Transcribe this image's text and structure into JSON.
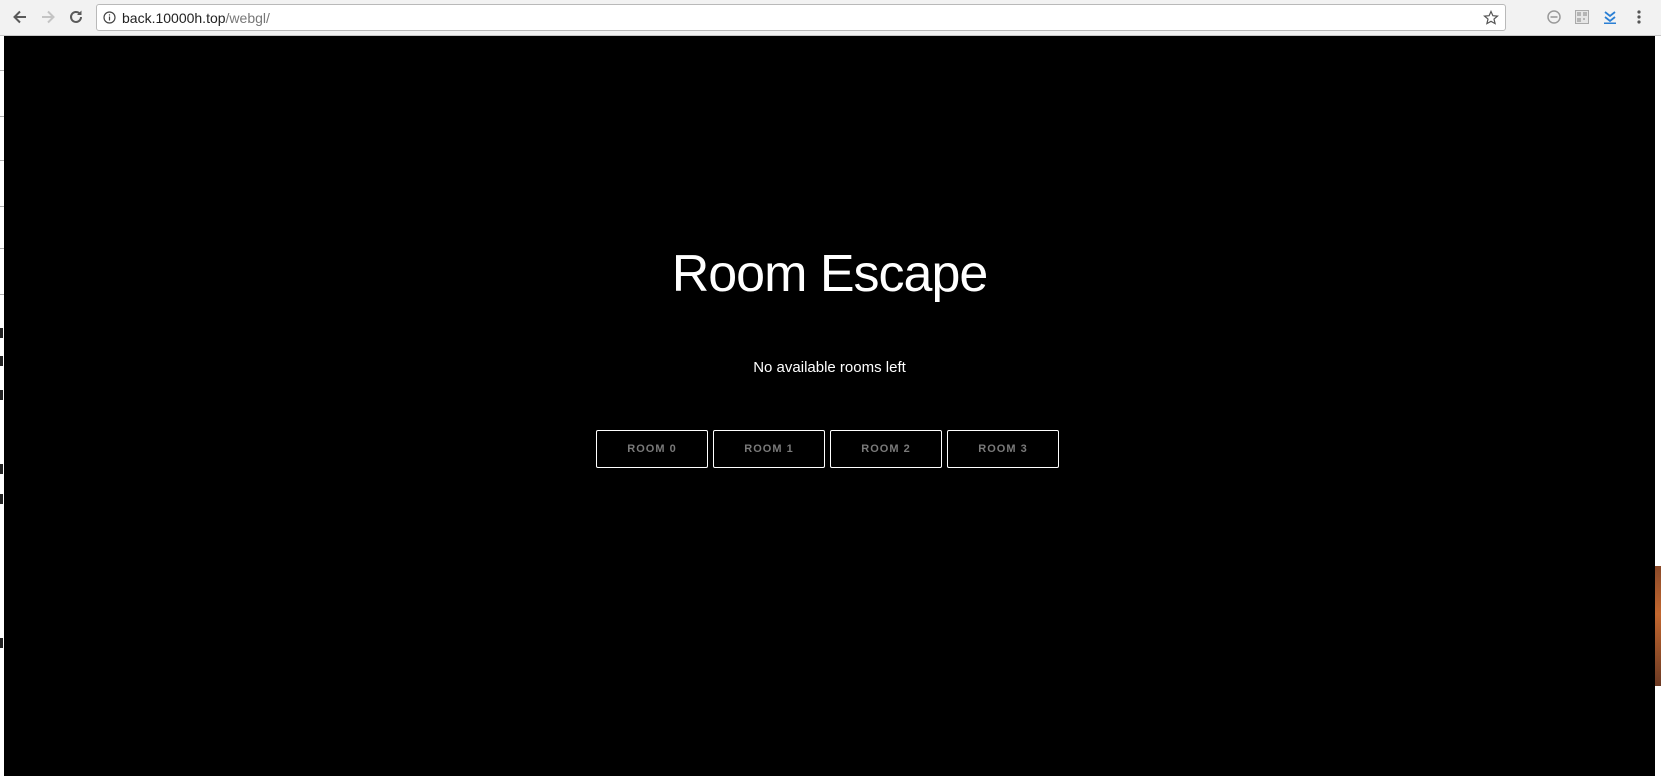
{
  "browser": {
    "url_host": "back.10000h.top",
    "url_path": "/webgl/",
    "icons": {
      "back": "back-arrow-icon",
      "forward": "forward-arrow-icon",
      "reload": "reload-icon",
      "info": "info-icon",
      "bookmark": "star-icon",
      "ext1": "block-icon",
      "ext2": "qr-icon",
      "ext3": "download-icon",
      "menu": "more-vert-icon"
    }
  },
  "page": {
    "title": "Room Escape",
    "subtitle": "No available rooms left",
    "rooms": [
      {
        "label": "ROOM 0"
      },
      {
        "label": "ROOM 1"
      },
      {
        "label": "ROOM 2"
      },
      {
        "label": "ROOM 3"
      }
    ]
  },
  "colors": {
    "canvas_bg": "#000000",
    "text": "#ffffff",
    "button_text": "#7a7a7a",
    "button_border": "#ffffff"
  }
}
